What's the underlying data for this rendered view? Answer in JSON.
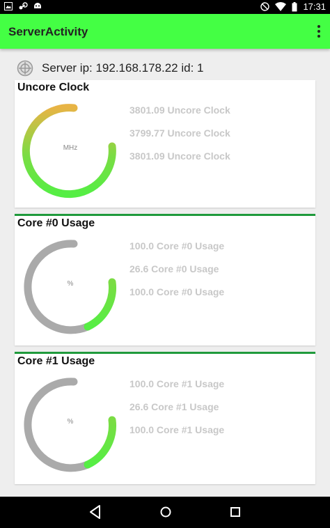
{
  "status_bar": {
    "time": "17:31",
    "left_icons": [
      "gallery-icon",
      "steam-icon",
      "android-icon"
    ],
    "right_icons": [
      "do-not-disturb-icon",
      "wifi-icon",
      "battery-icon"
    ]
  },
  "app_bar": {
    "title": "ServerActivity",
    "menu_icon": "overflow-menu-icon",
    "color": "#44ff44"
  },
  "server": {
    "icon": "server-target-icon",
    "text": "Server ip: 192.168.178.22 id: 1"
  },
  "cards": [
    {
      "title": "Uncore Clock",
      "unit": "MHz",
      "gauge_level": 1.0,
      "readings": [
        "3801.09 Uncore Clock",
        "3799.77 Uncore Clock",
        "3801.09 Uncore Clock"
      ]
    },
    {
      "title": "Core #0 Usage",
      "unit": "%",
      "gauge_level": 0.27,
      "readings": [
        "100.0 Core #0 Usage",
        "26.6 Core #0 Usage",
        "100.0 Core #0 Usage"
      ]
    },
    {
      "title": "Core #1 Usage",
      "unit": "%",
      "gauge_level": 0.27,
      "readings": [
        "100.0 Core #1 Usage",
        "26.6 Core #1 Usage",
        "100.0 Core #1 Usage"
      ]
    }
  ],
  "colors": {
    "gauge_track": "#aaaaaa",
    "gauge_green": "#55ee44",
    "gauge_orange": "#e8b445",
    "card_accent": "#1f9a3c",
    "reading_text": "#c8c8c8"
  },
  "nav_bar": {
    "back_icon": "back-icon",
    "home_icon": "home-icon",
    "recents_icon": "recents-icon"
  }
}
